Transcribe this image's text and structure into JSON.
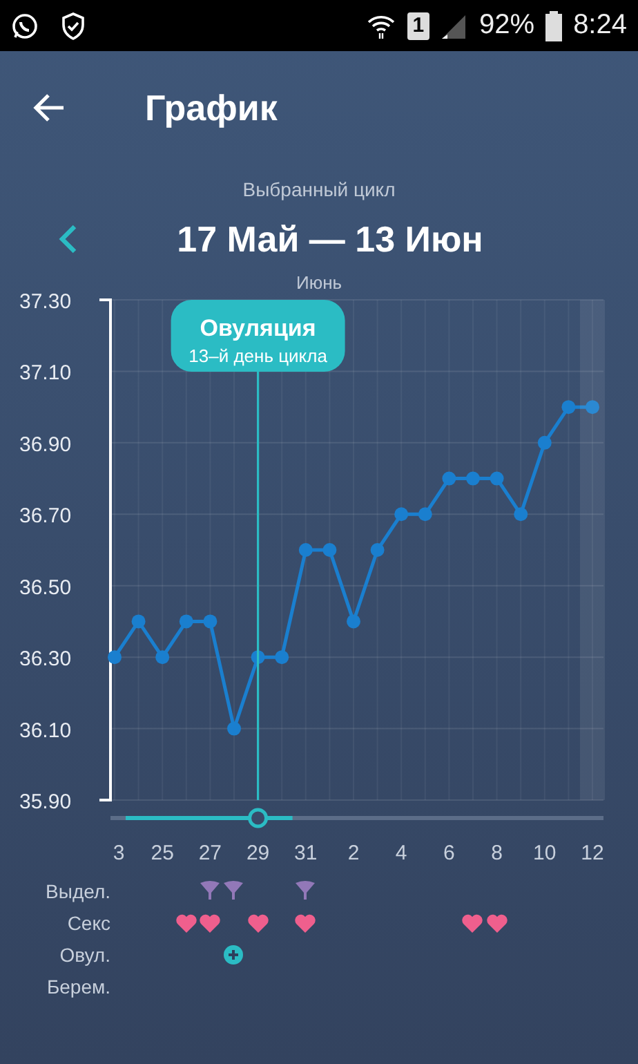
{
  "status_bar": {
    "sim": "1",
    "battery": "92%",
    "time": "8:24"
  },
  "app_bar": {
    "title": "График"
  },
  "cycle": {
    "caption": "Выбранный цикл",
    "range": "17 Май — 13 Июн"
  },
  "chart": {
    "month": "Июнь",
    "chart_data": {
      "type": "line",
      "categories": [
        "3",
        null,
        "25",
        null,
        "27",
        null,
        "29",
        null,
        "31",
        null,
        "2",
        null,
        "4",
        null,
        "6",
        null,
        "8",
        null,
        "10",
        null,
        "12"
      ],
      "grid": true,
      "series": [
        {
          "color": "#1a7fcf",
          "marker": "o",
          "values": [
            36.3,
            36.4,
            36.3,
            36.4,
            36.4,
            36.1,
            36.3,
            36.3,
            36.6,
            36.6,
            36.4,
            36.6,
            36.7,
            36.7,
            36.8,
            36.8,
            36.8,
            36.7,
            36.9,
            37.0,
            37.0
          ]
        }
      ],
      "ylim": [
        35.9,
        37.3
      ],
      "yticks": [
        {
          "value": 35.9,
          "label": "35.90"
        },
        {
          "value": 36.1,
          "label": "36.10"
        },
        {
          "value": 36.3,
          "label": "36.30"
        },
        {
          "value": 36.5,
          "label": "36.50"
        },
        {
          "value": 36.7,
          "label": "36.70"
        },
        {
          "value": 36.9,
          "label": "36.90"
        },
        {
          "value": 37.1,
          "label": "37.10"
        },
        {
          "value": 37.3,
          "label": "37.30"
        }
      ],
      "annotations": [
        "Овуляция",
        "13–й день цикла"
      ],
      "ref_lines": [
        {
          "axis": "x",
          "value": "29"
        }
      ]
    }
  },
  "markers": [
    {
      "label": "Выдел.",
      "kind": "discharge",
      "days": [
        false,
        false,
        false,
        false,
        true,
        true,
        false,
        false,
        true,
        false,
        false,
        false,
        false,
        false,
        false,
        false,
        false,
        false,
        false,
        false,
        false
      ]
    },
    {
      "label": "Секс",
      "kind": "heart",
      "days": [
        false,
        false,
        false,
        true,
        true,
        false,
        true,
        false,
        true,
        false,
        false,
        false,
        false,
        false,
        false,
        true,
        true,
        false,
        false,
        false,
        false
      ]
    },
    {
      "label": "Овул.",
      "kind": "ovulation",
      "days": [
        false,
        false,
        false,
        false,
        false,
        true,
        false,
        false,
        false,
        false,
        false,
        false,
        false,
        false,
        false,
        false,
        false,
        false,
        false,
        false,
        false
      ]
    },
    {
      "label": "Берем.",
      "kind": "pregnancy",
      "days": [
        false,
        false,
        false,
        false,
        false,
        false,
        false,
        false,
        false,
        false,
        false,
        false,
        false,
        false,
        false,
        false,
        false,
        false,
        false,
        false,
        false
      ]
    }
  ]
}
